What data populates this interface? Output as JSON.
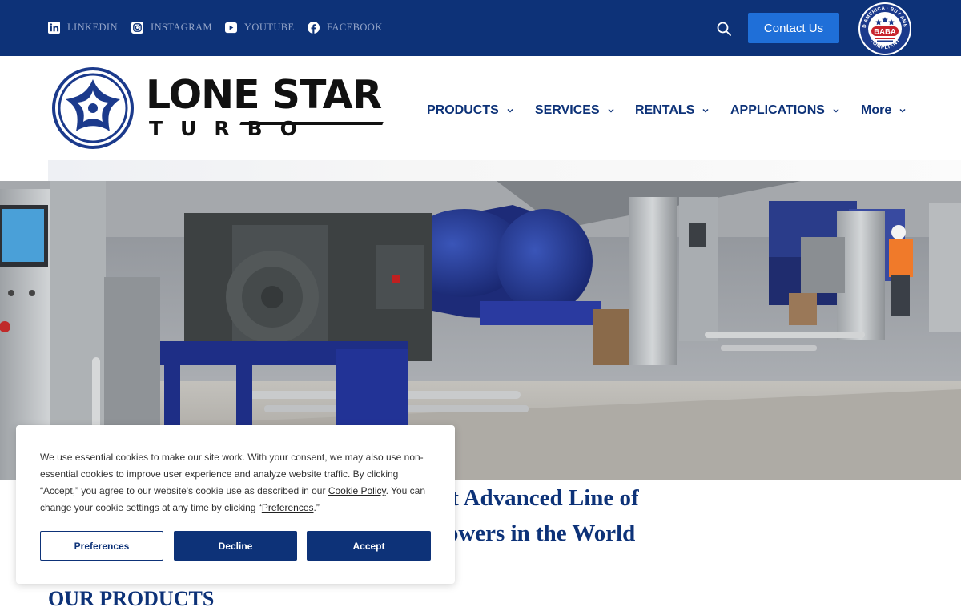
{
  "topbar": {
    "social": [
      {
        "label": "LINKEDIN",
        "icon": "linkedin-icon"
      },
      {
        "label": "INSTAGRAM",
        "icon": "instagram-icon"
      },
      {
        "label": "YOUTUBE",
        "icon": "youtube-icon"
      },
      {
        "label": "FACEBOOK",
        "icon": "facebook-icon"
      }
    ],
    "search_icon": "search-icon",
    "contact_label": "Contact Us",
    "badge": {
      "top_text": "BUILD AMERICA · BUY AMERICA",
      "center_text": "BABA",
      "bottom_text": "COMPLIANT"
    }
  },
  "logo": {
    "line1": "LONE STAR",
    "line2": "TURBO"
  },
  "nav": [
    {
      "label": "PRODUCTS"
    },
    {
      "label": "SERVICES"
    },
    {
      "label": "RENTALS"
    },
    {
      "label": "APPLICATIONS"
    },
    {
      "label": "More"
    }
  ],
  "hero": {
    "headline_line1": "e Most Advanced Line of",
    "headline_line2": "rs and Blowers in the World"
  },
  "section": {
    "title": "OUR PRODUCTS"
  },
  "cookie": {
    "text_part1": "We use essential cookies to make our site work. With your consent, we may also use non-essential cookies to improve user experience and analyze website traffic. By clicking “Accept,” you agree to our website's cookie use as described in our ",
    "policy_link": "Cookie Policy",
    "text_part2": ". You can change your cookie settings at any time by clicking “",
    "preferences_link": "Preferences",
    "text_part3": ".”",
    "buttons": {
      "preferences": "Preferences",
      "decline": "Decline",
      "accept": "Accept"
    }
  },
  "colors": {
    "brand_navy": "#0d3278",
    "contact_blue": "#1f6fd8",
    "logo_blue": "#1b3a8c",
    "badge_red": "#c8232c"
  }
}
